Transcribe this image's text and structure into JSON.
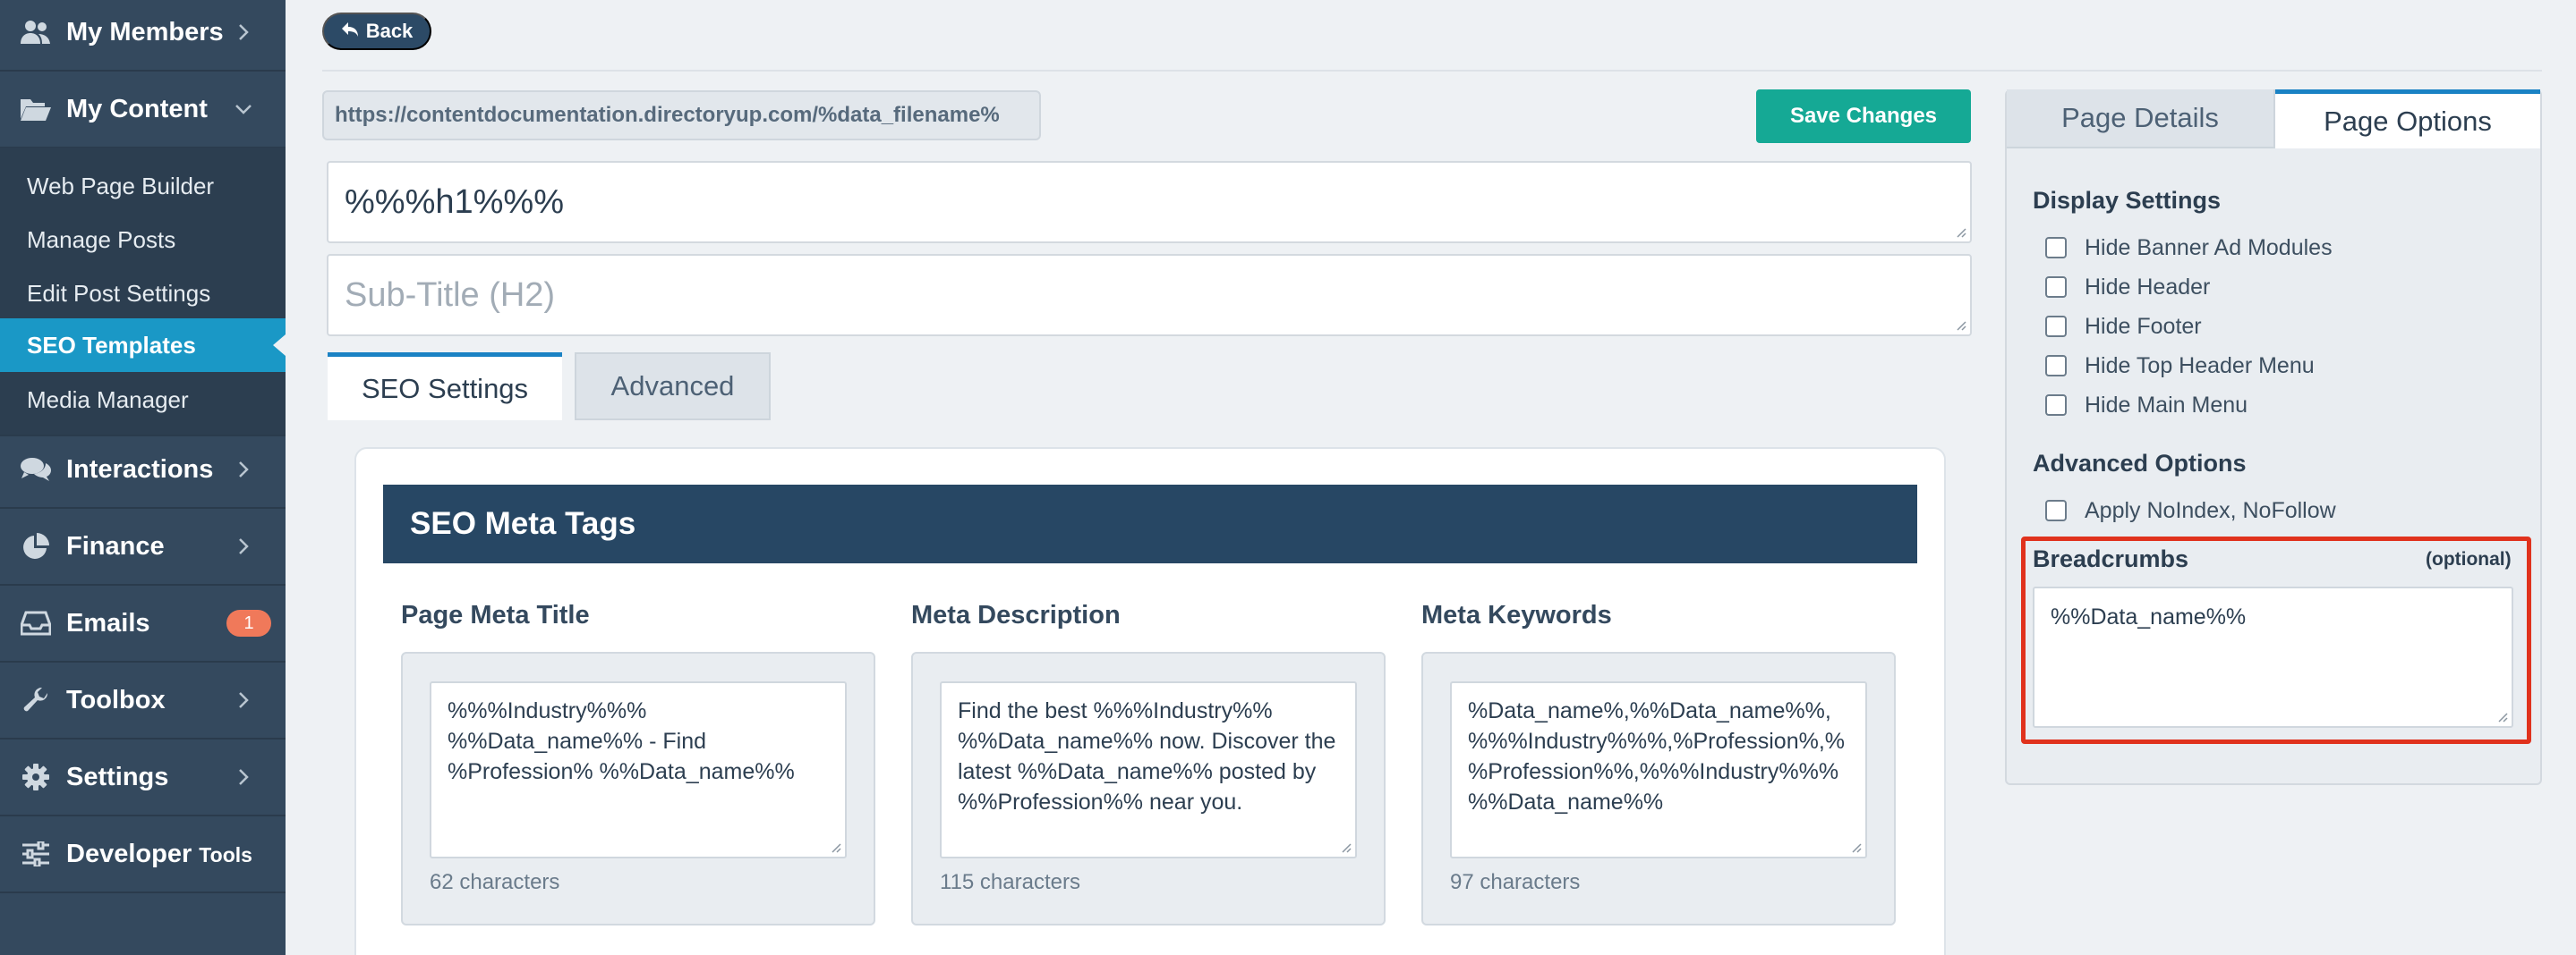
{
  "sidebar": {
    "my_members": "My Members",
    "my_content": "My Content",
    "sub_items": [
      {
        "label": "Web Page Builder"
      },
      {
        "label": "Manage Posts"
      },
      {
        "label": "Edit Post Settings"
      },
      {
        "label": "SEO Templates"
      },
      {
        "label": "Media Manager"
      }
    ],
    "interactions": "Interactions",
    "finance": "Finance",
    "emails": "Emails",
    "emails_badge": "1",
    "toolbox": "Toolbox",
    "settings": "Settings",
    "developer": "Developer",
    "developer_small": "Tools"
  },
  "topbar": {
    "back_label": "Back"
  },
  "main": {
    "url": "https://contentdocumentation.directoryup.com/%data_filename%",
    "save_label": "Save Changes",
    "h1_value": "%%%h1%%%",
    "h2_placeholder": "Sub-Title (H2)",
    "tabs": [
      {
        "label": "SEO Settings"
      },
      {
        "label": "Advanced"
      }
    ],
    "card_title": "SEO Meta Tags",
    "columns": [
      {
        "label": "Page Meta Title",
        "value": "%%%Industry%%% %%Data_name%% - Find %Profession% %%Data_name%%",
        "count": "62 characters"
      },
      {
        "label": "Meta Description",
        "value": "Find the best %%%Industry%% %%Data_name%% now. Discover the latest %%Data_name%% posted by %%Profession%% near you.",
        "count": "115 characters"
      },
      {
        "label": "Meta Keywords",
        "value": "%Data_name%,%%Data_name%%, %%%Industry%%%,%Profession%,% %Profession%%,%%%Industry%%% %%Data_name%%",
        "count": "97 characters"
      }
    ]
  },
  "right_panel": {
    "tabs": [
      {
        "label": "Page Details"
      },
      {
        "label": "Page Options"
      }
    ],
    "display_settings_title": "Display Settings",
    "display_options": [
      {
        "label": "Hide Banner Ad Modules"
      },
      {
        "label": "Hide Header"
      },
      {
        "label": "Hide Footer"
      },
      {
        "label": "Hide Top Header Menu"
      },
      {
        "label": "Hide Main Menu"
      }
    ],
    "advanced_options_title": "Advanced Options",
    "advanced_options": [
      {
        "label": "Apply NoIndex, NoFollow"
      }
    ],
    "breadcrumbs_title": "Breadcrumbs",
    "breadcrumbs_optional": "(optional)",
    "breadcrumbs_value": "%%Data_name%%"
  },
  "colors": {
    "sidebar_bg": "#34495e",
    "active_item": "#1a98c6",
    "save_button": "#15a995",
    "card_header": "#274764",
    "highlight_border": "#e0321d",
    "badge": "#f0795a"
  }
}
